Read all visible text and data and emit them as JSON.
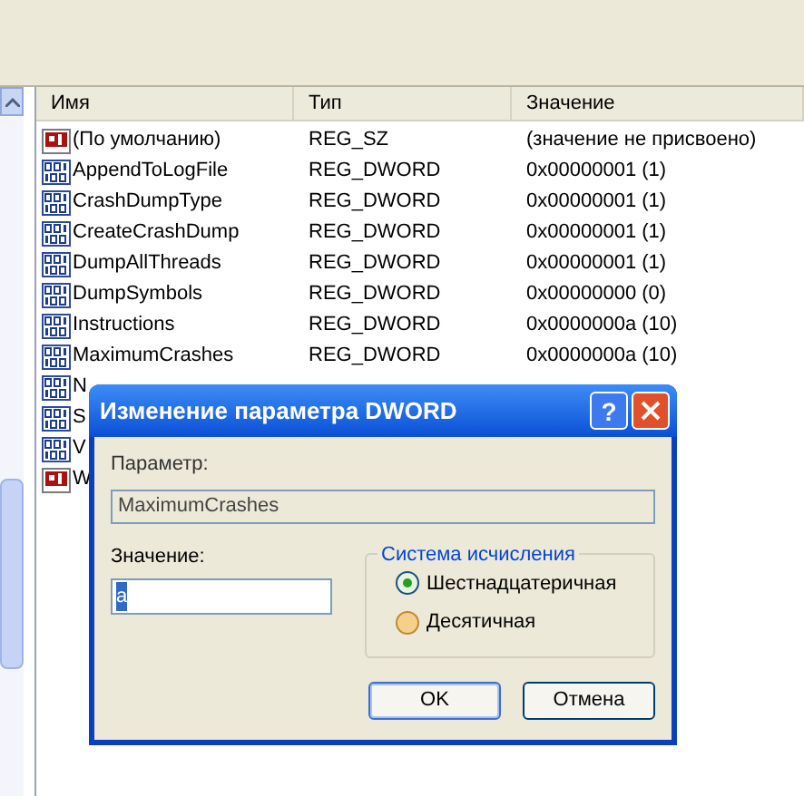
{
  "table": {
    "columns": [
      "Имя",
      "Тип",
      "Значение"
    ],
    "rows": [
      {
        "kind": "string",
        "name": "(По умолчанию)",
        "type": "REG_SZ",
        "value": "(значение не присвоено)"
      },
      {
        "kind": "binary",
        "name": "AppendToLogFile",
        "type": "REG_DWORD",
        "value": "0x00000001 (1)"
      },
      {
        "kind": "binary",
        "name": "CrashDumpType",
        "type": "REG_DWORD",
        "value": "0x00000001 (1)"
      },
      {
        "kind": "binary",
        "name": "CreateCrashDump",
        "type": "REG_DWORD",
        "value": "0x00000001 (1)"
      },
      {
        "kind": "binary",
        "name": "DumpAllThreads",
        "type": "REG_DWORD",
        "value": "0x00000001 (1)"
      },
      {
        "kind": "binary",
        "name": "DumpSymbols",
        "type": "REG_DWORD",
        "value": "0x00000000 (0)"
      },
      {
        "kind": "binary",
        "name": "Instructions",
        "type": "REG_DWORD",
        "value": "0x0000000a (10)"
      },
      {
        "kind": "binary",
        "name": "MaximumCrashes",
        "type": "REG_DWORD",
        "value": "0x0000000a (10)"
      },
      {
        "kind": "binary",
        "name": "N"
      },
      {
        "kind": "binary",
        "name": "S"
      },
      {
        "kind": "binary",
        "name": "V"
      },
      {
        "kind": "string",
        "name": "W"
      }
    ]
  },
  "dialog": {
    "title": "Изменение параметра DWORD",
    "help": "?",
    "param_label": "Параметр:",
    "param_value": "MaximumCrashes",
    "value_label": "Значение:",
    "value": "a",
    "base_group": {
      "title": "Система исчисления",
      "options": [
        {
          "label": "Шестнадцатеричная",
          "selected": true
        },
        {
          "label": "Десятичная",
          "selected": false
        }
      ]
    },
    "buttons": [
      "OK",
      "Отмена"
    ]
  }
}
